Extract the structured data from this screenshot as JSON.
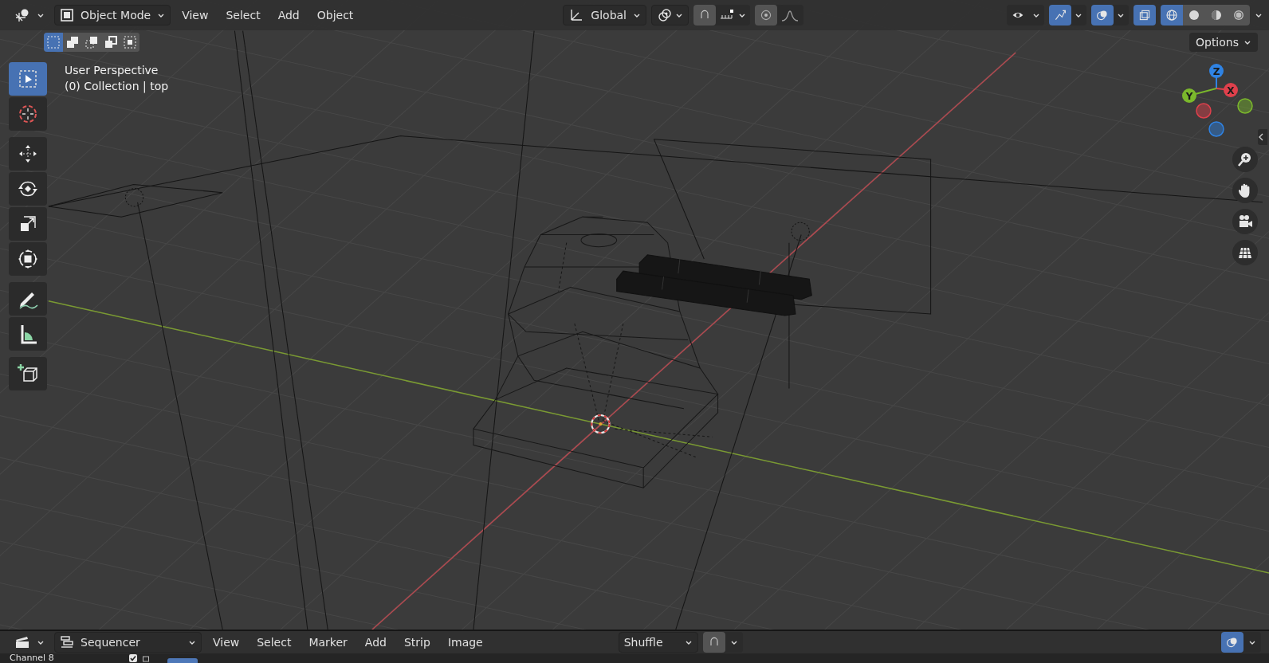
{
  "header": {
    "mode": "Object Mode",
    "menus": [
      "View",
      "Select",
      "Add",
      "Object"
    ],
    "orientation": "Global",
    "toggles": [
      {
        "kind": "snap",
        "on": false
      },
      {
        "kind": "proportional",
        "on": false
      },
      {
        "kind": "visibility",
        "on": false
      },
      {
        "kind": "gizmo",
        "on": true
      },
      {
        "kind": "overlays",
        "on": true
      },
      {
        "kind": "xray",
        "on": true
      }
    ],
    "shading": [
      {
        "kind": "wireframe",
        "selected": true
      },
      {
        "kind": "solid",
        "selected": false
      },
      {
        "kind": "material",
        "selected": false
      },
      {
        "kind": "rendered",
        "selected": false
      }
    ]
  },
  "tool_header": {
    "select_modes": [
      {
        "kind": "set",
        "selected": true
      },
      {
        "kind": "extend",
        "selected": false
      },
      {
        "kind": "subtract",
        "selected": false
      },
      {
        "kind": "difference",
        "selected": false
      },
      {
        "kind": "intersect",
        "selected": false
      }
    ],
    "options": "Options"
  },
  "viewport": {
    "overlay_text": [
      "User Perspective",
      "(0) Collection | top"
    ]
  },
  "toolbar": {
    "tools": [
      {
        "kind": "select",
        "selected": true
      },
      {
        "kind": "cursor",
        "selected": false
      },
      {
        "kind": "move",
        "selected": false
      },
      {
        "kind": "rotate",
        "selected": false
      },
      {
        "kind": "scale",
        "selected": false
      },
      {
        "kind": "transform",
        "selected": false
      },
      {
        "kind": "annotate",
        "selected": false
      },
      {
        "kind": "measure",
        "selected": false
      },
      {
        "kind": "add-cube",
        "selected": false
      }
    ]
  },
  "navigation_gizmo": {
    "axes": [
      {
        "label": "Z",
        "color": "#2f83e4"
      },
      {
        "label": "X",
        "color": "#e0404c"
      },
      {
        "label": "Y",
        "color": "#7bb82c"
      }
    ]
  },
  "sequencer_header": {
    "editor": "Sequencer",
    "menus": [
      "View",
      "Select",
      "Marker",
      "Add",
      "Strip",
      "Image"
    ],
    "overlap_mode": "Shuffle",
    "snap": {
      "on": false
    },
    "overlays": {
      "on": true
    }
  },
  "channel_row": {
    "label": "Channel 8",
    "checked": true
  }
}
